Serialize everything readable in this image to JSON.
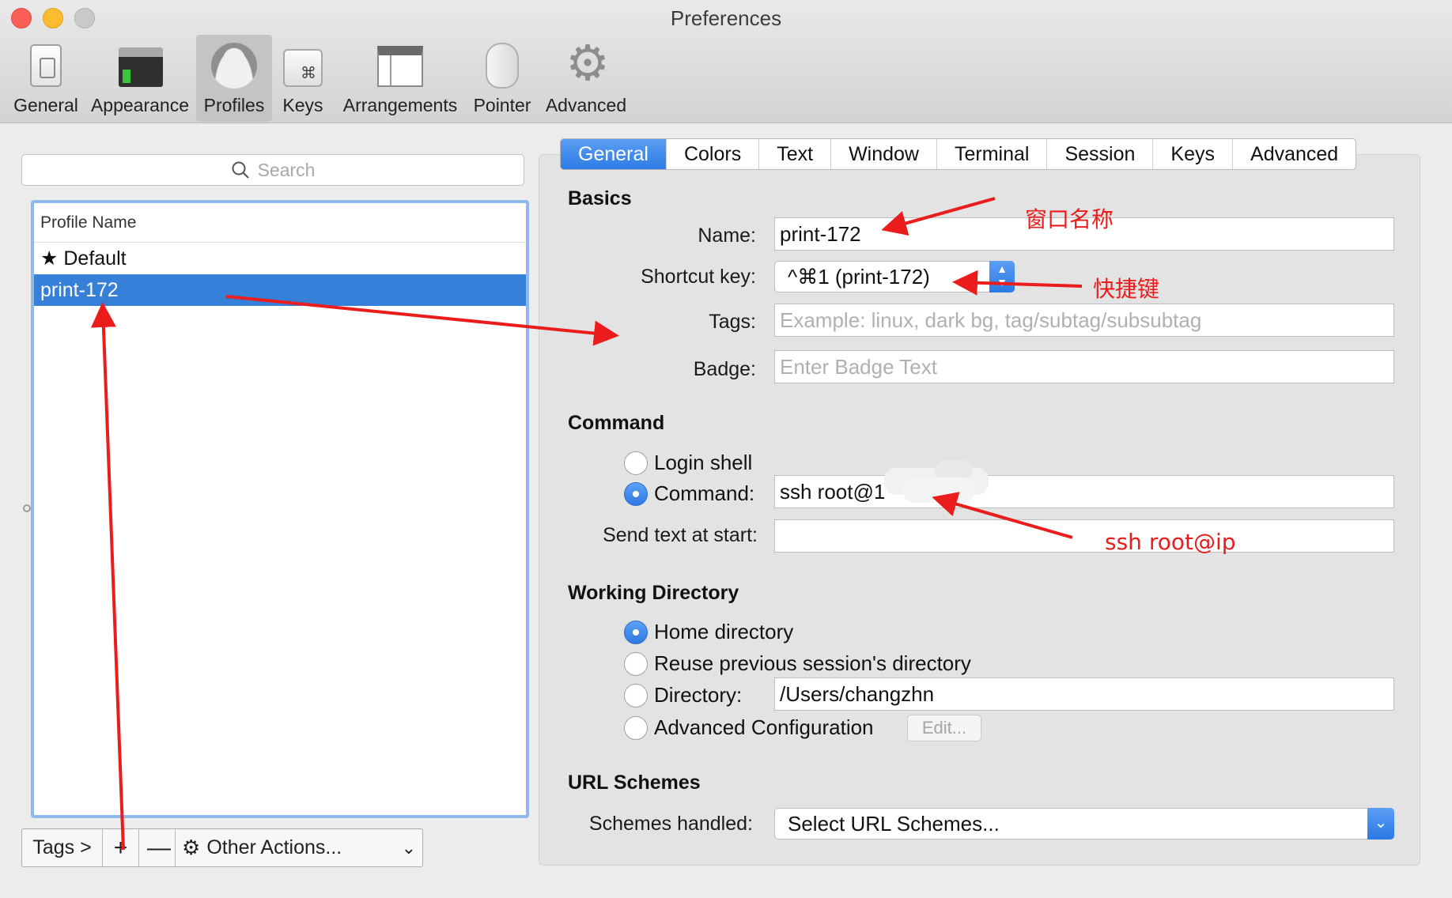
{
  "window": {
    "title": "Preferences"
  },
  "toolbar": {
    "items": [
      {
        "label": "General",
        "icon": "general-icon"
      },
      {
        "label": "Appearance",
        "icon": "appearance-icon"
      },
      {
        "label": "Profiles",
        "icon": "profiles-icon",
        "selected": true
      },
      {
        "label": "Keys",
        "icon": "keys-icon"
      },
      {
        "label": "Arrangements",
        "icon": "arrangements-icon"
      },
      {
        "label": "Pointer",
        "icon": "pointer-icon"
      },
      {
        "label": "Advanced",
        "icon": "gear-icon"
      }
    ],
    "keys_glyph": "⌘"
  },
  "sidebar": {
    "search_placeholder": "Search",
    "column_header": "Profile Name",
    "profiles": [
      {
        "name": "★ Default"
      },
      {
        "name": "print-172",
        "selected": true
      }
    ],
    "bottom": {
      "tags_label": "Tags >",
      "add_label": "+",
      "remove_label": "—",
      "other_actions_label": "Other Actions...",
      "gear_glyph": "⚙",
      "chevron_glyph": "⌄"
    }
  },
  "tabs": {
    "items": [
      "General",
      "Colors",
      "Text",
      "Window",
      "Terminal",
      "Session",
      "Keys",
      "Advanced"
    ],
    "active": "General"
  },
  "basics": {
    "heading": "Basics",
    "name_label": "Name:",
    "name_value": "print-172",
    "shortcut_label": "Shortcut key:",
    "shortcut_value": "^⌘1 (print-172)",
    "tags_label": "Tags:",
    "tags_placeholder": "Example: linux, dark bg, tag/subtag/subsubtag",
    "badge_label": "Badge:",
    "badge_placeholder": "Enter Badge Text"
  },
  "command": {
    "heading": "Command",
    "login_shell_label": "Login shell",
    "command_label": "Command:",
    "command_value": "ssh root@1",
    "selected": "command",
    "send_text_label": "Send text at start:",
    "send_text_value": ""
  },
  "working_directory": {
    "heading": "Working Directory",
    "home_label": "Home directory",
    "reuse_label": "Reuse previous session's directory",
    "directory_label": "Directory:",
    "directory_value": "/Users/changzhn",
    "advanced_label": "Advanced Configuration",
    "edit_label": "Edit...",
    "selected": "home"
  },
  "url_schemes": {
    "heading": "URL Schemes",
    "schemes_label": "Schemes handled:",
    "schemes_value": "Select URL Schemes..."
  },
  "annotations": {
    "window_name": "窗口名称",
    "shortcut": "快捷键",
    "ssh": "ssh root@ip",
    "color": "#ea1c1c"
  },
  "colors": {
    "accent": "#3680d9",
    "selection": "#3680d9",
    "annotation": "#ea1c1c"
  }
}
